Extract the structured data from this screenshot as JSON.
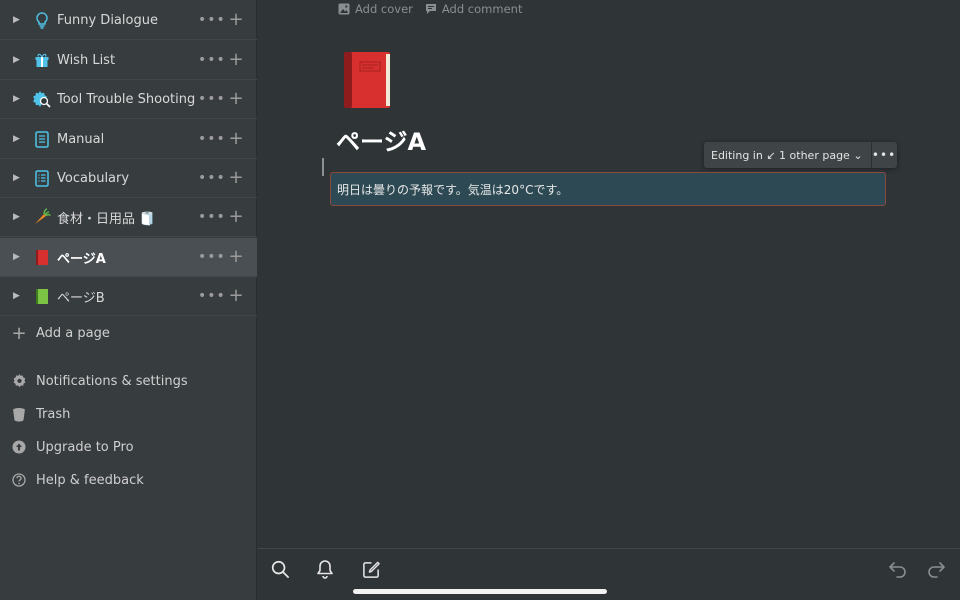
{
  "sidebar": {
    "pages": [
      {
        "label": "Funny Dialogue",
        "emoji_icon": "lightbulb-icon",
        "toggle": "▶",
        "more": "•••",
        "add": "+"
      },
      {
        "label": "Wish List",
        "emoji_icon": "gift-icon",
        "toggle": "▶",
        "more": "•••",
        "add": "+"
      },
      {
        "label": "Tool Trouble Shooting",
        "emoji_icon": "gear-magnifier-icon",
        "toggle": "▶",
        "more": "•••",
        "add": "+"
      },
      {
        "label": "Manual",
        "emoji_icon": "document-icon",
        "toggle": "▶",
        "more": "•••",
        "add": "+"
      },
      {
        "label": "Vocabulary",
        "emoji_icon": "list-document-icon",
        "toggle": "▶",
        "more": "•••",
        "add": "+"
      },
      {
        "label": "食材・日用品 🧻",
        "emoji_icon": "carrot-icon",
        "toggle": "▶",
        "more": "•••",
        "add": "+"
      },
      {
        "label": "ページA",
        "emoji_icon": "red-book-icon",
        "toggle": "▶",
        "more": "•••",
        "add": "+",
        "active": true
      },
      {
        "label": "ページB",
        "emoji_icon": "green-book-icon",
        "toggle": "▶",
        "more": "•••",
        "add": "+"
      }
    ],
    "add_page": "Add a page",
    "links": [
      {
        "label": "Notifications & settings",
        "icon": "gear-icon"
      },
      {
        "label": "Trash",
        "icon": "trash-icon"
      },
      {
        "label": "Upgrade to Pro",
        "icon": "upgrade-icon"
      },
      {
        "label": "Help & feedback",
        "icon": "help-icon"
      }
    ]
  },
  "main": {
    "add_cover": "Add cover",
    "add_comment": "Add comment",
    "title": "ページA",
    "editing_pill": "Editing in ↙ 1 other page ⌄",
    "editing_more": "•••",
    "block_text": "明日は曇りの予報です。気温は20°Cです。"
  },
  "colors": {
    "sidebar_bg": "#373c3f",
    "main_bg": "#2f3437",
    "active_item_bg": "#4a4f53",
    "selected_block_bg": "#2d4a54",
    "selected_block_border": "#8a4a3c"
  }
}
